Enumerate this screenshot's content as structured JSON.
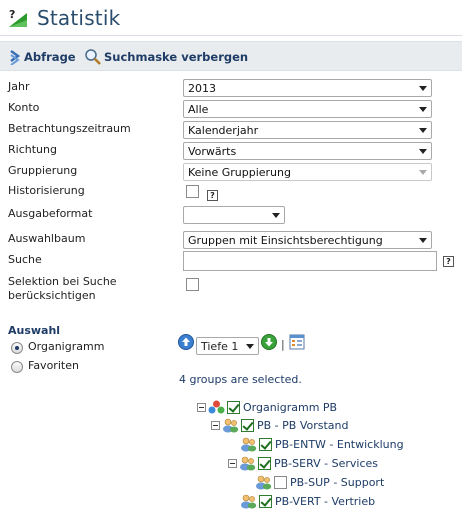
{
  "header": {
    "title": "Statistik"
  },
  "toolbar": {
    "query_label": "Abfrage",
    "hide_search_label": "Suchmaske verbergen"
  },
  "form": {
    "year": {
      "label": "Jahr",
      "value": "2013"
    },
    "account": {
      "label": "Konto",
      "value": "Alle"
    },
    "period": {
      "label": "Betrachtungszeitraum",
      "value": "Kalenderjahr"
    },
    "direction": {
      "label": "Richtung",
      "value": "Vorwärts"
    },
    "grouping": {
      "label": "Gruppierung",
      "value": "Keine Gruppierung"
    },
    "history": {
      "label": "Historisierung",
      "help": "?"
    },
    "output_format": {
      "label": "Ausgabeformat",
      "value": ""
    },
    "selection_tree": {
      "label": "Auswahlbaum",
      "value": "Gruppen mit Einsichtsberechtigung"
    },
    "search": {
      "label": "Suche",
      "value": "",
      "help": "?"
    },
    "search_selection": {
      "label_line1": "Selektion bei Suche",
      "label_line2": "berücksichtigen"
    }
  },
  "selection": {
    "title": "Auswahl",
    "options": [
      {
        "label": "Organigramm",
        "selected": true
      },
      {
        "label": "Favoriten",
        "selected": false
      }
    ],
    "depth": {
      "value": "Tiefe 1"
    },
    "separator": "|",
    "status": "4 groups are selected."
  },
  "tree": [
    {
      "label": "Organigramm PB",
      "checked": true
    },
    {
      "label": "PB - PB Vorstand",
      "checked": true
    },
    {
      "label": "PB-ENTW - Entwicklung",
      "checked": true
    },
    {
      "label": "PB-SERV - Services",
      "checked": true
    },
    {
      "label": "PB-SUP - Support",
      "checked": false
    },
    {
      "label": "PB-VERT - Vertrieb",
      "checked": true
    }
  ],
  "colors": {
    "title": "#2a4d6e",
    "link": "#1e3c66",
    "toolbar_bg": "#e9ecee"
  }
}
